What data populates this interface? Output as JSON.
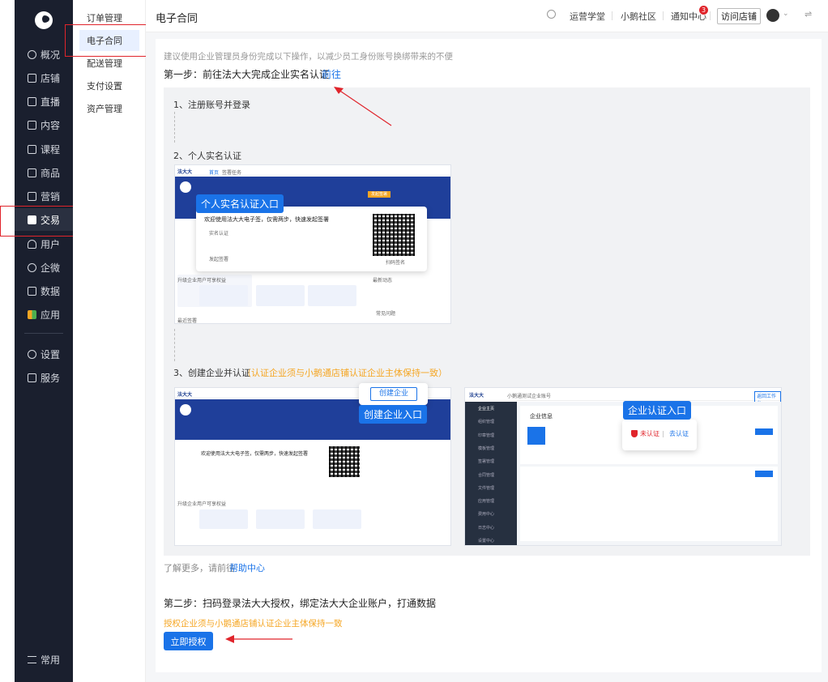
{
  "sidebar": {
    "items": [
      {
        "label": "概况",
        "icon": "dashboard-icon"
      },
      {
        "label": "店铺",
        "icon": "store-icon"
      },
      {
        "label": "直播",
        "icon": "live-icon"
      },
      {
        "label": "内容",
        "icon": "content-icon"
      },
      {
        "label": "课程",
        "icon": "course-icon"
      },
      {
        "label": "商品",
        "icon": "goods-icon"
      },
      {
        "label": "营销",
        "icon": "marketing-icon"
      },
      {
        "label": "交易",
        "icon": "trade-icon"
      },
      {
        "label": "用户",
        "icon": "user-icon"
      },
      {
        "label": "企微",
        "icon": "wecom-icon"
      },
      {
        "label": "数据",
        "icon": "data-icon"
      },
      {
        "label": "应用",
        "icon": "apps-icon"
      },
      {
        "label": "设置",
        "icon": "settings-icon"
      },
      {
        "label": "服务",
        "icon": "service-icon"
      }
    ],
    "bottom_label": "常用"
  },
  "subnav": {
    "items": [
      "订单管理",
      "电子合同",
      "配送管理",
      "支付设置",
      "资产管理"
    ]
  },
  "topbar": {
    "title": "电子合同",
    "links": [
      "运营学堂",
      "小鹅社区",
      "通知中心"
    ],
    "notify_count": "3",
    "visit_store": "访问店铺"
  },
  "main": {
    "notice": "建议使用企业管理员身份完成以下操作，以减少员工身份账号换绑带来的不便",
    "step1_title": "第一步：前往法大大完成企业实名认证",
    "step1_link": "前往",
    "sub1": "1、注册账号并登录",
    "sub2": "2、个人实名认证",
    "sub3_prefix": "3、创建企业并认证",
    "sub3_note": "（认证企业须与小鹅通店铺认证企业主体保持一致）",
    "learn_more": "了解更多，请前往",
    "help_link": "帮助中心",
    "step2_title": "第二步：扫码登录法大大授权，绑定法大大企业账户，打通数据",
    "step2_note": "授权企业须与小鹅通店铺认证企业主体保持一致",
    "authorize_button": "立即授权"
  },
  "shots": {
    "shot1": {
      "brand": "法大大",
      "tabs": [
        "首页",
        "签署任务"
      ],
      "tooltip": "个人实名认证入口",
      "welcome": "欢迎使用法大大电子签，仅需两步，快速发起签署",
      "step_a": "实名认证",
      "step_b": "发起签署",
      "qr_caption": "扫码签名",
      "orange_btn": "发起签署",
      "section": "升级企业用户可享权益",
      "recent": "最新动态",
      "faq": "常见问题",
      "recent_sign": "最近签署"
    },
    "shot2": {
      "brand": "法大大",
      "tooltip": "创建企业入口",
      "create_btn": "创建企业",
      "welcome": "欢迎使用法大大电子签，仅需两步，快速发起签署",
      "section": "升级企业用户可享权益"
    },
    "shot3": {
      "brand": "法大大",
      "account": "小鹅通测试企业账号",
      "tooltip": "企业认证入口",
      "unverified": "未认证",
      "go_verify": "去认证",
      "info_title": "企业信息",
      "switch_btn": "返回工作台",
      "side_items": [
        "企业主页",
        "组织管理",
        "印章管理",
        "模板管理",
        "签署管理",
        "合同管理",
        "文件管理",
        "应用管理",
        "费用中心",
        "日志中心",
        "设置中心"
      ]
    }
  },
  "colors": {
    "accent": "#1a73e8",
    "annotation": "#e0242b",
    "warning": "#f5a623",
    "sidebar": "#1a1f2e"
  }
}
